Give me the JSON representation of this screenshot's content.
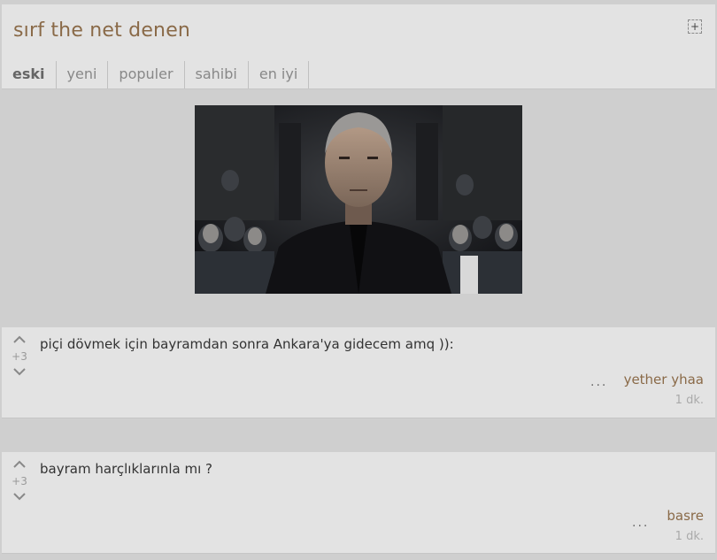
{
  "topic": {
    "title": "sırf the net denen",
    "expand_icon": "plus-square-icon",
    "tabs": [
      "eski",
      "yeni",
      "populer",
      "sahibi",
      "en iyi"
    ],
    "active_tab": "eski"
  },
  "media": {
    "description_icon": "movie-still-image"
  },
  "entries": [
    {
      "text": "piçi dövmek için bayramdan sonra Ankara'ya gidecem amq )):",
      "score": "+3",
      "author": "yether yhaa",
      "time": "1 dk.",
      "menu": "..."
    },
    {
      "text": "bayram harçlıklarınla mı ?",
      "score": "+3",
      "author": "basre",
      "time": "1 dk.",
      "menu": "..."
    }
  ]
}
